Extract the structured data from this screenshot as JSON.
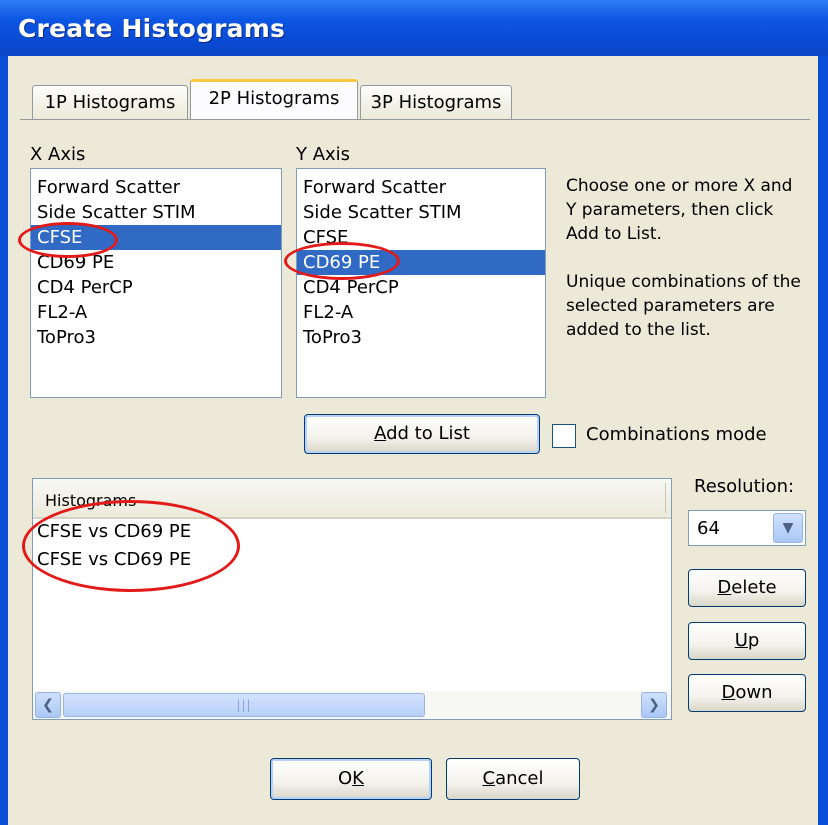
{
  "window": {
    "title": "Create Histograms"
  },
  "tabs": [
    {
      "label": "1P Histograms",
      "active": false
    },
    {
      "label": "2P Histograms",
      "active": true
    },
    {
      "label": "3P Histograms",
      "active": false
    }
  ],
  "x_axis": {
    "label": "X Axis",
    "items": [
      "Forward Scatter",
      "Side Scatter STIM",
      "CFSE",
      "CD69 PE",
      "CD4 PerCP",
      "FL2-A",
      "ToPro3"
    ],
    "selected": "CFSE"
  },
  "y_axis": {
    "label": "Y Axis",
    "items": [
      "Forward Scatter",
      "Side Scatter STIM",
      "CFSE",
      "CD69 PE",
      "CD4 PerCP",
      "FL2-A",
      "ToPro3"
    ],
    "selected": "CD69 PE"
  },
  "help_text": {
    "line1": "Choose one or more X and Y parameters, then click Add to List.",
    "line2": "Unique combinations of the selected parameters are added to the list."
  },
  "add_to_list": {
    "label_pre": "",
    "label_accel": "A",
    "label_post": "dd to List"
  },
  "combinations_mode": {
    "label": "Combinations mode",
    "checked": false
  },
  "histograms": {
    "header": "Histograms",
    "rows": [
      "CFSE vs CD69 PE",
      "CFSE vs CD69 PE"
    ]
  },
  "resolution": {
    "label": "Resolution:",
    "value": "64"
  },
  "buttons": {
    "delete": {
      "accel": "D",
      "rest": "elete"
    },
    "up": {
      "accel": "U",
      "rest": "p"
    },
    "down": {
      "accel": "D",
      "rest": "own"
    },
    "ok": {
      "pre": "O",
      "accel": "K",
      "rest": ""
    },
    "cancel": {
      "accel": "C",
      "rest": "ancel"
    }
  },
  "icons": {
    "scroll_left": "chevron-left-icon",
    "scroll_right": "chevron-right-icon",
    "scroll_grip": "grip-icon",
    "dropdown": "chevron-down-icon"
  },
  "colors": {
    "titlebar": "#0a4fd8",
    "selection": "#316ac5",
    "annotation": "#e21a1a",
    "tab_highlight": "#ffc83c"
  }
}
